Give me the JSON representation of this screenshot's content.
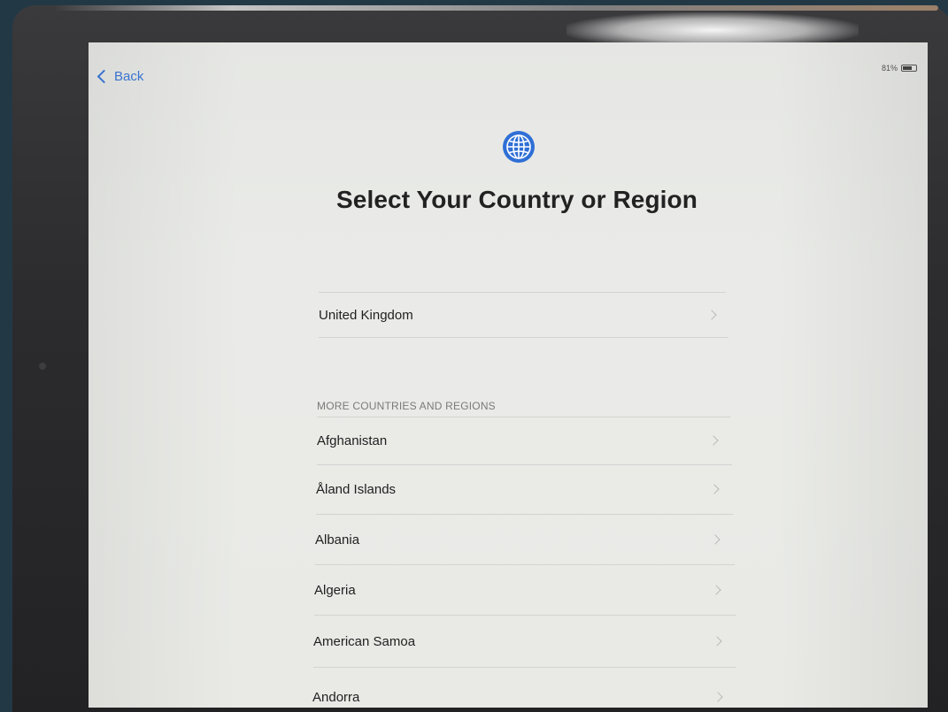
{
  "nav": {
    "back_label": "Back"
  },
  "status_bar": {
    "battery_percent": "81%",
    "battery_level": 0.81
  },
  "header": {
    "title": "Select Your Country or Region",
    "icon": "globe-icon",
    "icon_color": "#2f6fd6"
  },
  "suggested": {
    "items": [
      {
        "label": "United Kingdom"
      }
    ]
  },
  "more": {
    "header": "MORE COUNTRIES AND REGIONS",
    "items": [
      {
        "label": "Afghanistan"
      },
      {
        "label": "Åland Islands"
      },
      {
        "label": "Albania"
      },
      {
        "label": "Algeria"
      },
      {
        "label": "American Samoa"
      },
      {
        "label": "Andorra"
      }
    ]
  },
  "colors": {
    "accent": "#3b78d8",
    "screen_background": "#e8e9e6",
    "bezel": "#2c2c2e",
    "backdrop": "#233845"
  }
}
